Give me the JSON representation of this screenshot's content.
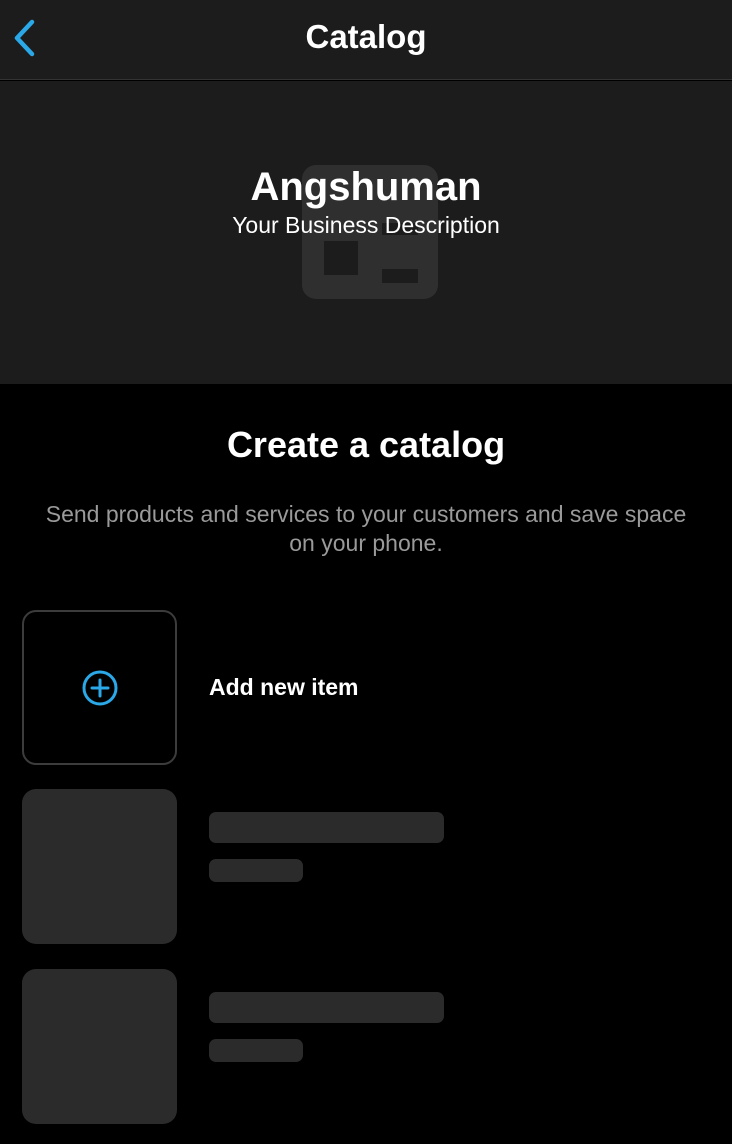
{
  "navbar": {
    "title": "Catalog",
    "back_icon": "chevron-left-icon"
  },
  "profile": {
    "business_name": "Angshuman",
    "business_description": "Your Business Description",
    "logo_icon": "business-logo-icon"
  },
  "catalog": {
    "title": "Create a catalog",
    "description": "Send products and services to your customers and save space on your phone.",
    "add_item_label": "Add new item",
    "add_icon": "plus-circle-icon"
  },
  "colors": {
    "accent": "#2aa8e8",
    "background": "#000000",
    "surface": "#1c1c1c",
    "placeholder": "#2b2b2b",
    "secondary_text": "#9a9a9a"
  }
}
